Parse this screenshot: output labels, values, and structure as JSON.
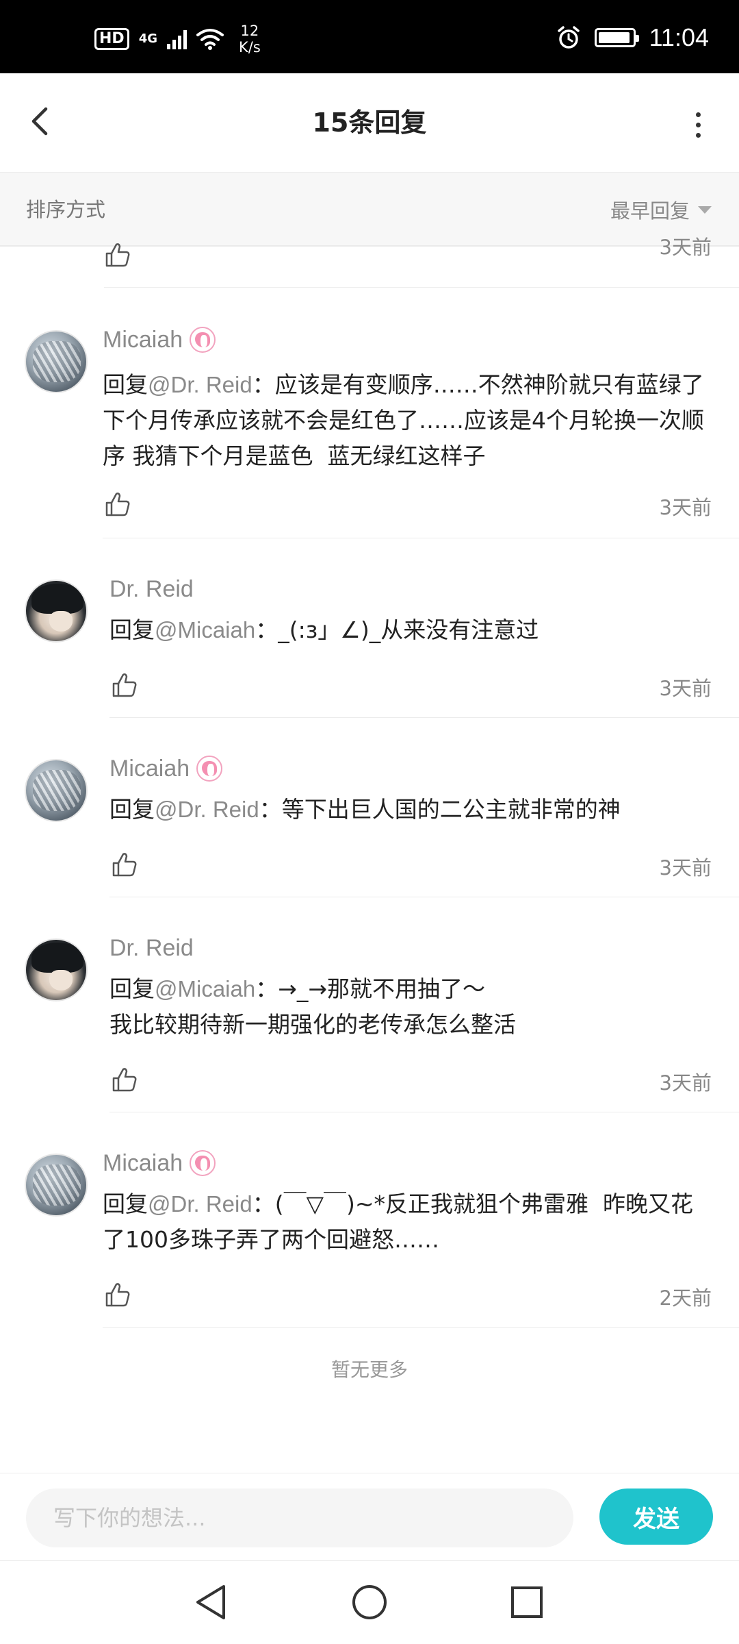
{
  "status_bar": {
    "hd": "HD",
    "network": "4G",
    "speed_value": "12",
    "speed_unit": "K/s",
    "time": "11:04",
    "battery_level": 0.9
  },
  "header": {
    "title": "15条回复"
  },
  "sort": {
    "label": "排序方式",
    "selected": "最早回复"
  },
  "partial": {
    "time": "3天前"
  },
  "replies": [
    {
      "user": "Micaiah",
      "prefix": "回复",
      "mention": "@Dr. Reid",
      "text": "：应该是有变顺序……不然神阶就只有蓝绿了  下个月传承应该就不会是红色了……应该是4个月轮换一次顺序 我猜下个月是蓝色  蓝无绿红这样子",
      "time": "3天前"
    },
    {
      "user": "Dr. Reid",
      "prefix": "回复",
      "mention": "@Micaiah",
      "text": "：_(:з」∠)_从来没有注意过",
      "time": "3天前"
    },
    {
      "user": "Micaiah",
      "prefix": "回复",
      "mention": "@Dr. Reid",
      "text": "：等下出巨人国的二公主就非常的神",
      "time": "3天前"
    },
    {
      "user": "Dr. Reid",
      "prefix": "回复",
      "mention": "@Micaiah",
      "text": "：→_→那就不用抽了～\n我比较期待新一期强化的老传承怎么整活",
      "time": "3天前"
    },
    {
      "user": "Micaiah",
      "prefix": "回复",
      "mention": "@Dr. Reid",
      "text": "：(￣▽￣)~*反正我就狙个弗雷雅  昨晚又花了100多珠子弄了两个回避怒……",
      "time": "2天前"
    }
  ],
  "footer_text": "暂无更多",
  "composer": {
    "placeholder": "写下你的想法...",
    "send_label": "发送"
  },
  "colors": {
    "accent": "#1fc3cc",
    "badge_pink": "#f48fb1"
  }
}
